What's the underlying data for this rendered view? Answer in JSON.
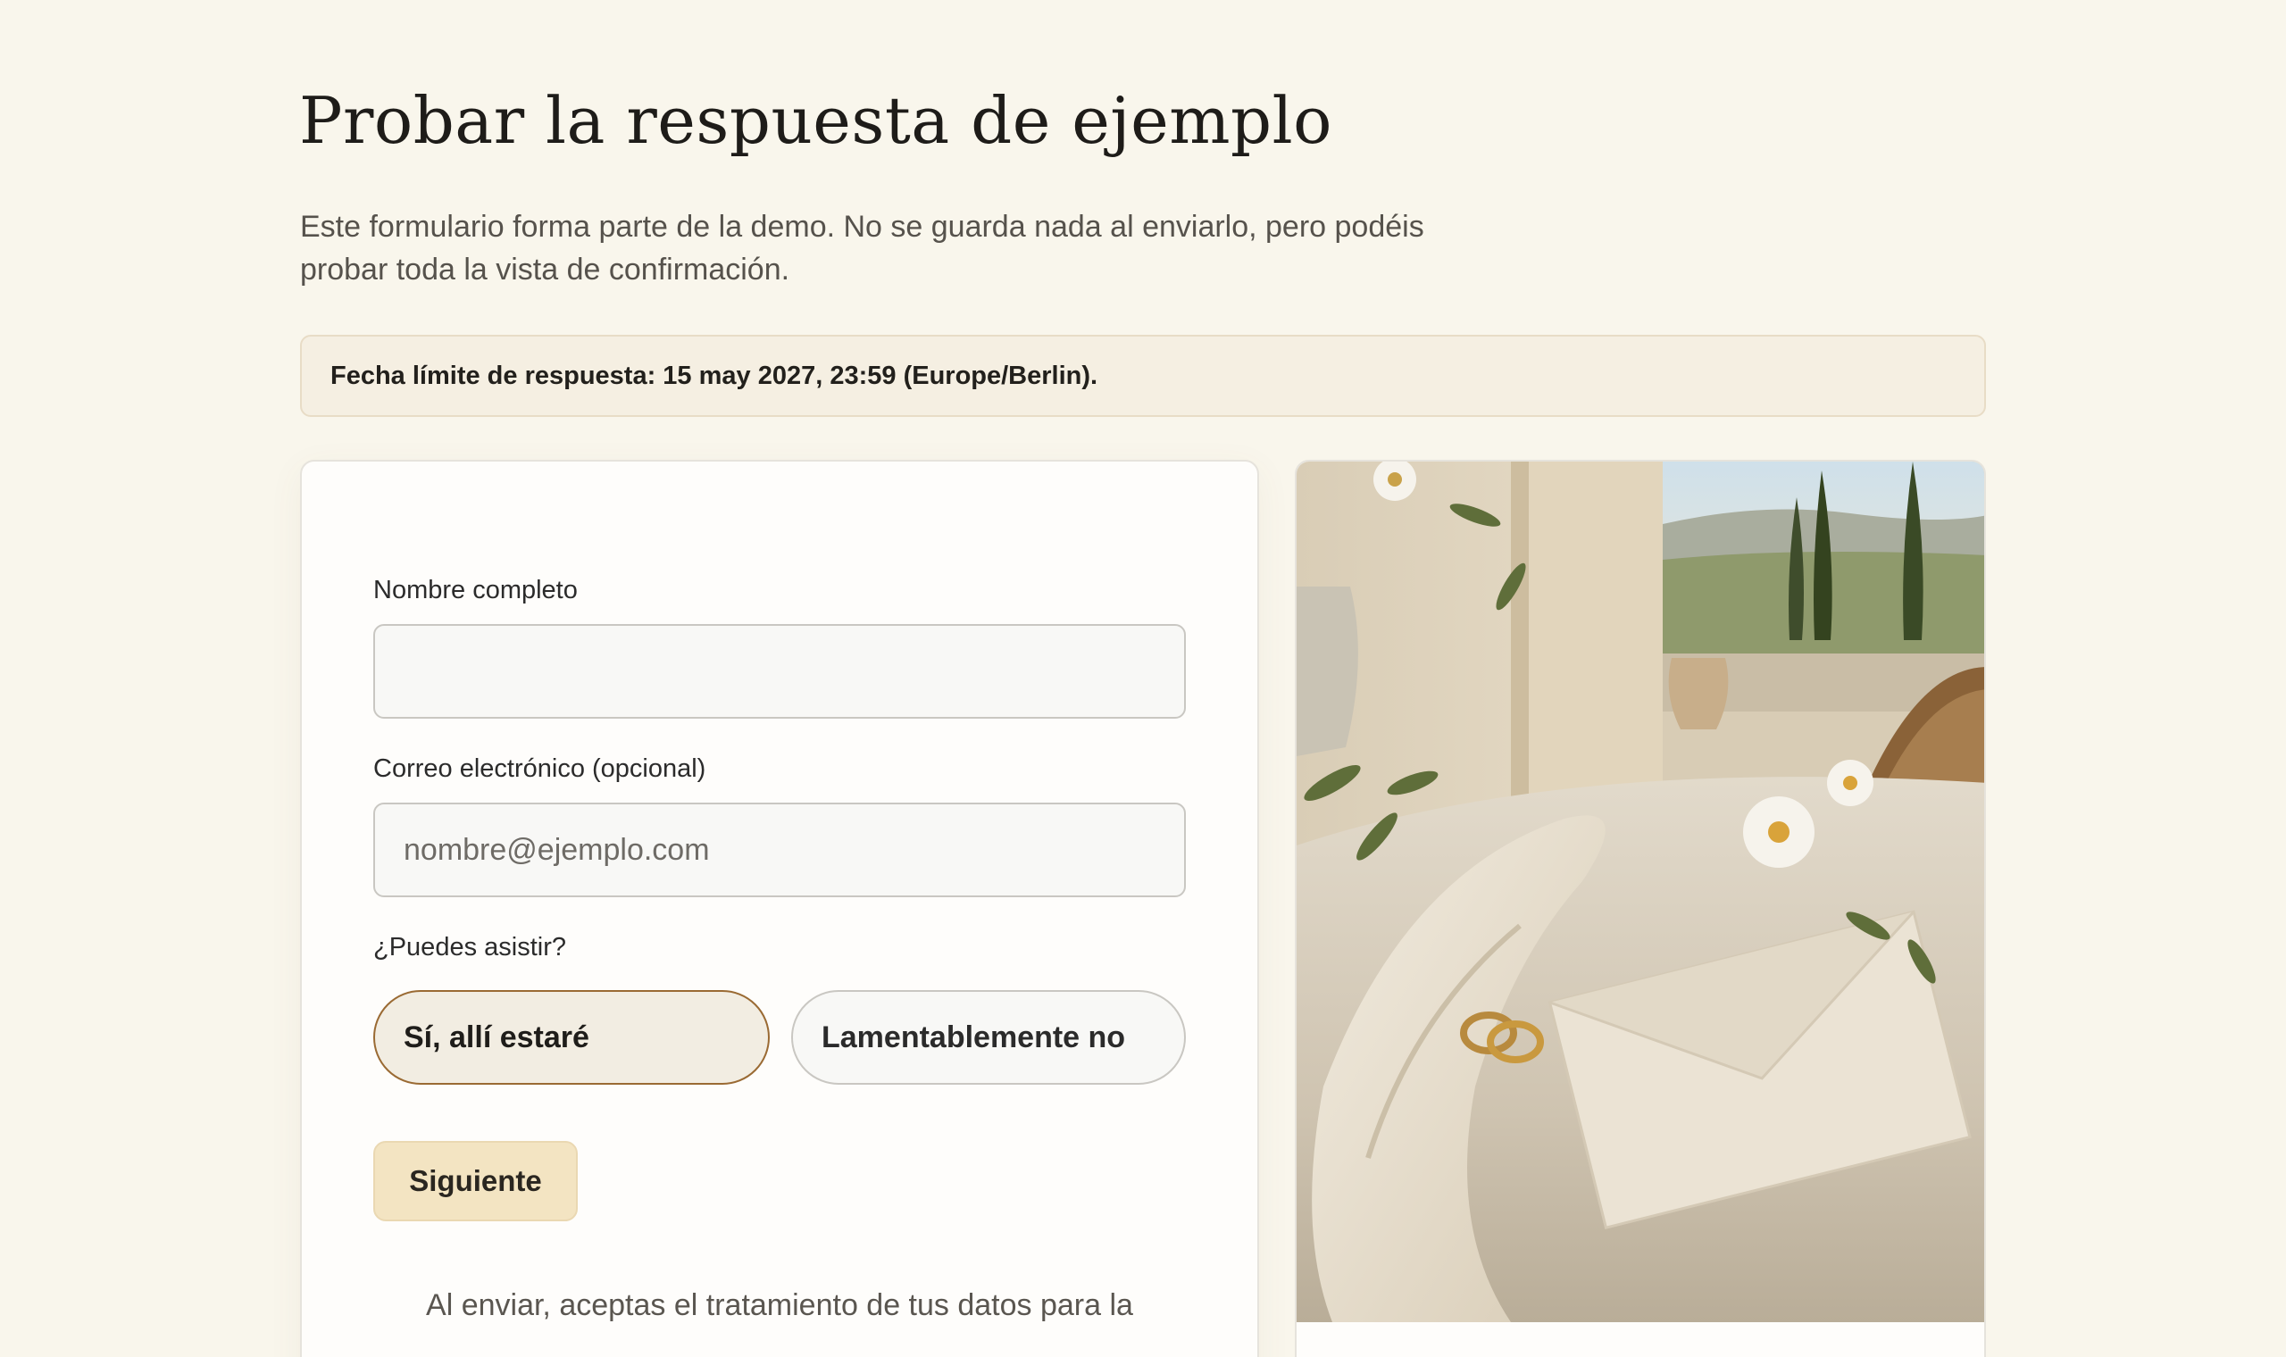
{
  "page": {
    "title": "Probar la respuesta de ejemplo",
    "intro": "Este formulario forma parte de la demo. No se guarda nada al enviarlo, pero podéis probar toda la vista de confirmación.",
    "deadline": "Fecha límite de respuesta: 15 may 2027, 23:59 (Europe/Berlin)."
  },
  "form": {
    "name_label": "Nombre completo",
    "name_value": "",
    "name_placeholder": "",
    "email_label": "Correo electrónico (opcional)",
    "email_value": "",
    "email_placeholder": "nombre@ejemplo.com",
    "attend_label": "¿Puedes asistir?",
    "attend_options": [
      {
        "label": "Sí, allí estaré",
        "selected": true
      },
      {
        "label": "Lamentablemente no",
        "selected": false
      }
    ],
    "next_label": "Siguiente",
    "consent_text": "Al enviar, aceptas el tratamiento de tus datos para la"
  },
  "photo": {
    "subject": "wedding-table-rings-envelope"
  },
  "colors": {
    "background": "#f9f6ec",
    "accent_border": "#9a6a33",
    "button_fill": "#f3e4c2",
    "banner_fill": "#f5efe2"
  }
}
